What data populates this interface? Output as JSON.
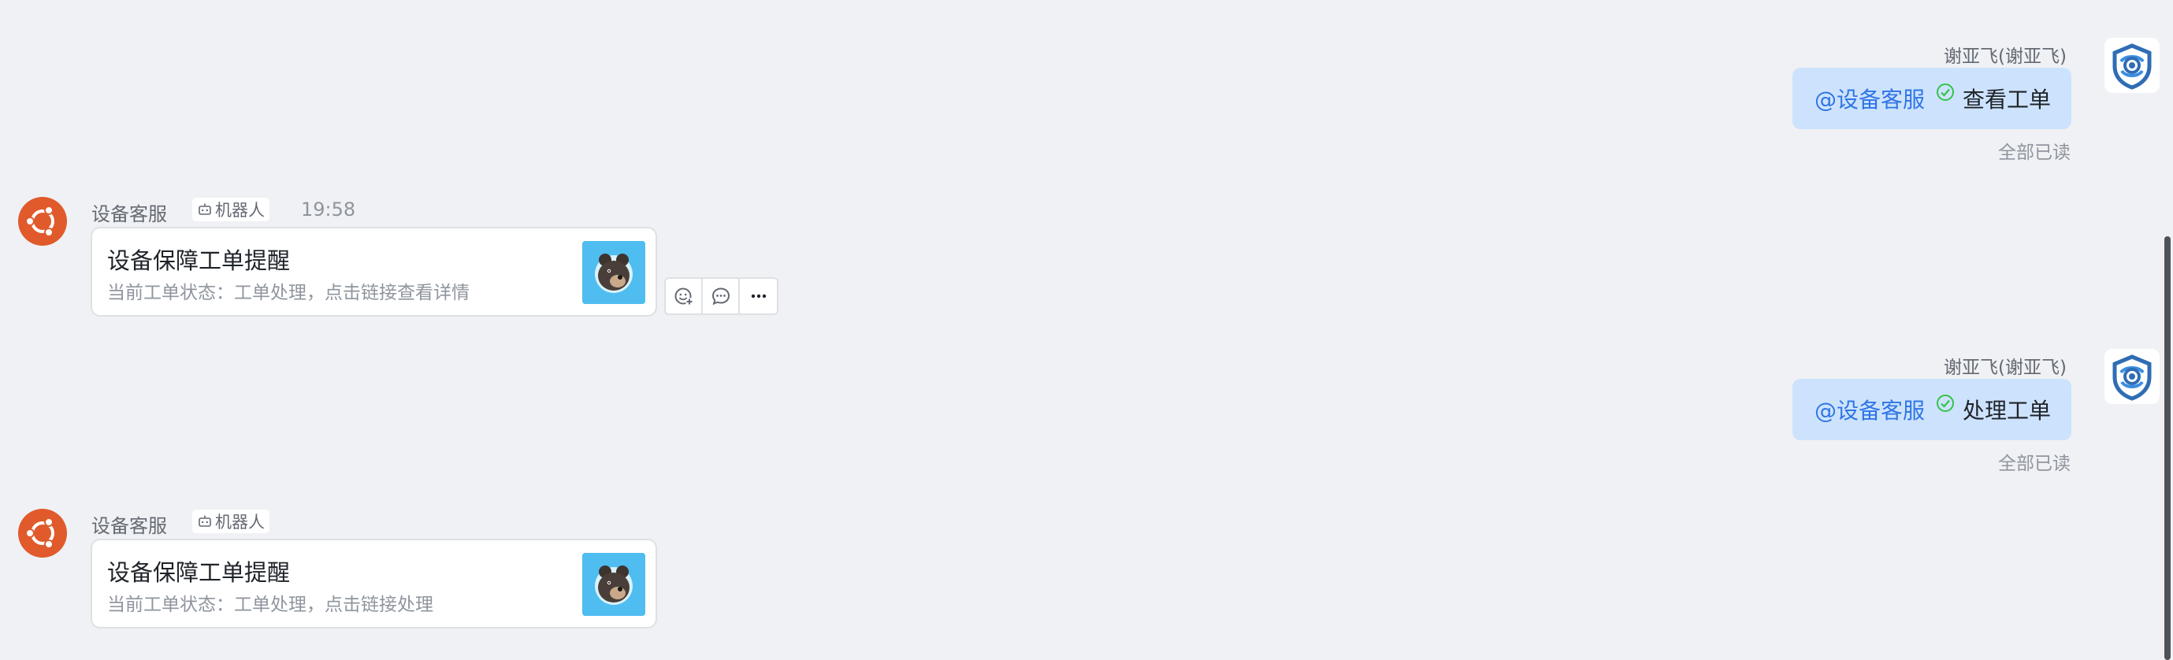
{
  "messages": [
    {
      "direction": "outgoing",
      "sender": "谢亚飞(谢亚飞)",
      "mention": "@设备客服",
      "text": "查看工单",
      "read_status": "全部已读"
    },
    {
      "direction": "incoming",
      "sender": "设备客服",
      "bot_label": "机器人",
      "time": "19:58",
      "card": {
        "title": "设备保障工单提醒",
        "desc": "当前工单状态：工单处理，点击链接查看详情"
      }
    },
    {
      "direction": "outgoing",
      "sender": "谢亚飞(谢亚飞)",
      "mention": "@设备客服",
      "text": "处理工单",
      "read_status": "全部已读"
    },
    {
      "direction": "incoming",
      "sender": "设备客服",
      "bot_label": "机器人",
      "card": {
        "title": "设备保障工单提醒",
        "desc": "当前工单状态：工单处理，点击链接处理"
      }
    }
  ],
  "hover_actions": [
    "add-reaction-icon",
    "reply-in-thread-icon",
    "more-options-icon"
  ],
  "colors": {
    "background": "#f0f1f4",
    "outgoing_bubble": "#cde3fd",
    "mention": "#2f75e5",
    "bot_avatar": "#e05a2b",
    "card_thumb": "#4fbdf0",
    "scroll_thumb": "#4e5359"
  }
}
